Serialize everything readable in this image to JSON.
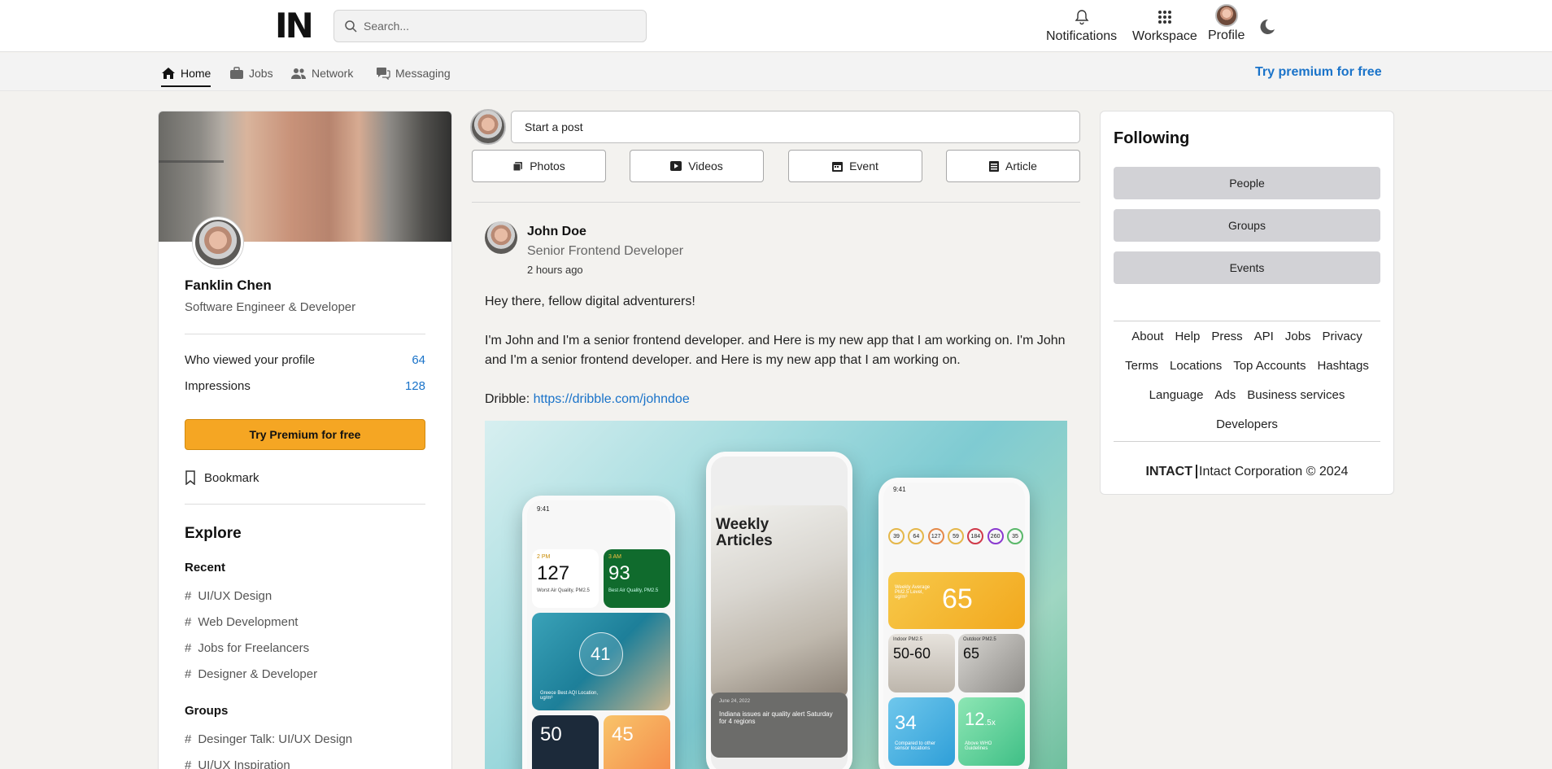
{
  "header": {
    "logo": "IN",
    "search_placeholder": "Search...",
    "nav": [
      {
        "label": "Notifications",
        "icon": "bell-icon"
      },
      {
        "label": "Workspace",
        "icon": "grid-icon"
      },
      {
        "label": "Profile",
        "icon": "avatar"
      }
    ],
    "theme_icon": "moon-icon"
  },
  "subnav": {
    "items": [
      {
        "label": "Home",
        "icon": "home-icon",
        "active": true
      },
      {
        "label": "Jobs",
        "icon": "briefcase-icon",
        "active": false
      },
      {
        "label": "Network",
        "icon": "people-icon",
        "active": false
      },
      {
        "label": "Messaging",
        "icon": "chat-icon",
        "active": false
      }
    ],
    "premium_link": "Try premium for free"
  },
  "profile": {
    "name": "Fanklin Chen",
    "title": "Software Engineer & Developer",
    "stats": [
      {
        "label": "Who viewed your profile",
        "value": "64"
      },
      {
        "label": "Impressions",
        "value": "128"
      }
    ],
    "premium_button": "Try Premium for free",
    "bookmark": "Bookmark",
    "explore": {
      "heading": "Explore",
      "recent_heading": "Recent",
      "recent": [
        "UI/UX Design",
        "Web Development",
        "Jobs for Freelancers",
        "Designer & Developer"
      ],
      "groups_heading": "Groups",
      "groups": [
        "Desinger Talk: UI/UX Design",
        "UI/UX Inspiration"
      ],
      "hash": "#"
    }
  },
  "composer": {
    "placeholder": "Start a post",
    "actions": [
      {
        "label": "Photos",
        "icon": "photo-icon"
      },
      {
        "label": "Videos",
        "icon": "video-icon"
      },
      {
        "label": "Event",
        "icon": "calendar-icon"
      },
      {
        "label": "Article",
        "icon": "article-icon"
      }
    ]
  },
  "post": {
    "author": "John Doe",
    "role": "Senior Frontend Developer",
    "time": "2 hours ago",
    "greeting": "Hey there, fellow digital adventurers!",
    "body": "I'm John and I'm a senior frontend developer. and Here is my new app that I am working on. I'm John and I'm a senior frontend developer. and Here is my new app that I am working on.",
    "link_label": "Dribble:",
    "link": "https://dribble.com/johndoe",
    "image": {
      "phone1": {
        "time": "9:41",
        "t1_time": "2 PM",
        "t1_value": "127",
        "t1_label": "Worst Air Quality, PM2.5",
        "t2_time": "3 AM",
        "t2_value": "93",
        "t2_label": "Best Air Quality, PM2.5",
        "map_value": "41",
        "map_label": "Greece Best AQI Location, ug/m³",
        "b1_value": "50",
        "b2_value": "45"
      },
      "phone2": {
        "title": "Weekly Articles",
        "date": "June 24, 2022",
        "headline": "Indiana issues air quality alert Saturday for 4 regions"
      },
      "phone3": {
        "time": "9:41",
        "circles": [
          "39",
          "64",
          "127",
          "59",
          "184",
          "260",
          "35"
        ],
        "big_value": "65",
        "big_label": "Weekly Average PM2.5 Level, ug/m³",
        "indoor_label": "Indoor PM2.5",
        "indoor_value": "50-60",
        "outdoor_label": "Outdoor PM2.5",
        "outdoor_value": "65",
        "c_value": "34",
        "c_label": "Compared to other sensor locations",
        "d_value": "12",
        "d_suffix": ".5x",
        "d_label": "Above WHO Guidelines"
      }
    }
  },
  "following": {
    "title": "Following",
    "buttons": [
      "People",
      "Groups",
      "Events"
    ],
    "links": [
      "About",
      "Help",
      "Press",
      "API",
      "Jobs",
      "Privacy",
      "Terms",
      "Locations",
      "Top Accounts",
      "Hashtags",
      "Language",
      "Ads",
      "Business services",
      "Developers"
    ],
    "brand": "INTACT",
    "copyright": "Intact Corporation © 2024"
  },
  "colors": {
    "accent": "#1a73c9",
    "premium": "#f5a623",
    "follow_button": "#d2d2d6"
  }
}
